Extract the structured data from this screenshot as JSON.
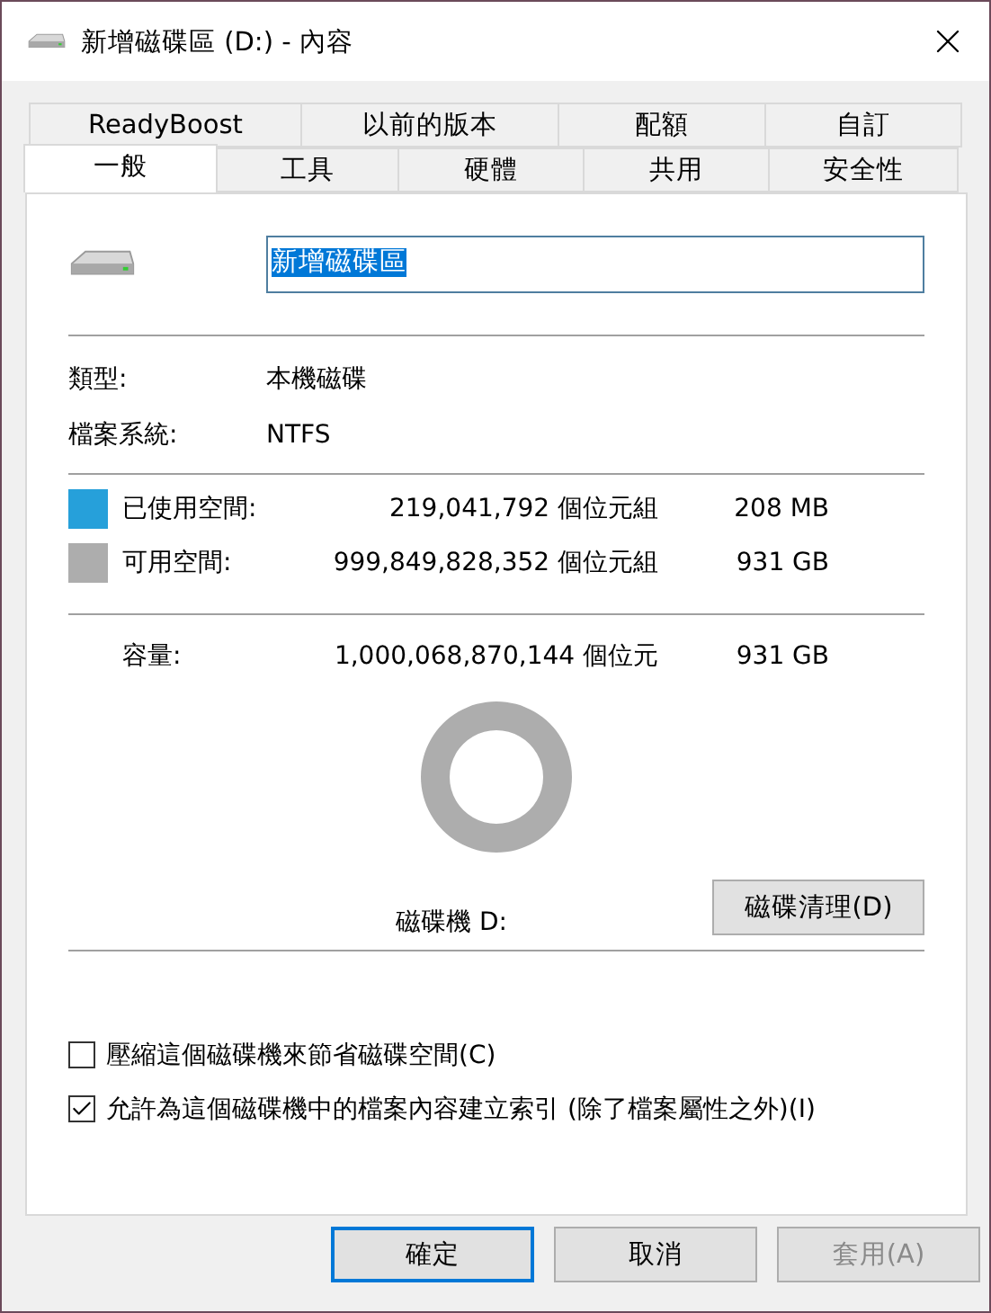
{
  "window": {
    "title": "新增磁碟區 (D:) - 內容"
  },
  "tab_rows": [
    [
      {
        "label": "ReadyBoost",
        "selected": false
      },
      {
        "label": "以前的版本",
        "selected": false
      },
      {
        "label": "配額",
        "selected": false
      },
      {
        "label": "自訂",
        "selected": false
      }
    ],
    [
      {
        "label": "一般",
        "selected": true
      },
      {
        "label": "工具",
        "selected": false
      },
      {
        "label": "硬體",
        "selected": false
      },
      {
        "label": "共用",
        "selected": false
      },
      {
        "label": "安全性",
        "selected": false
      }
    ]
  ],
  "name_field": {
    "value": "新增磁碟區",
    "text_selected": true
  },
  "info": [
    {
      "label": "類型:",
      "value": "本機磁碟"
    },
    {
      "label": "檔案系統:",
      "value": "NTFS"
    }
  ],
  "space": [
    {
      "label": "已使用空間:",
      "bytes": "219,041,792 個位元組",
      "size": "208 MB",
      "color": "#26a0da"
    },
    {
      "label": "可用空間:",
      "bytes": "999,849,828,352 個位元組",
      "size": "931 GB",
      "color": "#adadad"
    }
  ],
  "capacity": {
    "label": "容量:",
    "bytes": "1,000,068,870,144 個位元",
    "size": "931 GB"
  },
  "drive_label": "磁碟機 D:",
  "cleanup_button": "磁碟清理(D)",
  "options": [
    {
      "label": "壓縮這個磁碟機來節省磁碟空間(C)",
      "checked": false
    },
    {
      "label": "允許為這個磁碟機中的檔案內容建立索引 (除了檔案屬性之外)(I)",
      "checked": true
    }
  ],
  "buttons": [
    {
      "label": "確定",
      "kind": "default",
      "disabled": false
    },
    {
      "label": "取消",
      "kind": "normal",
      "disabled": false
    },
    {
      "label": "套用(A)",
      "kind": "normal",
      "disabled": true
    }
  ]
}
